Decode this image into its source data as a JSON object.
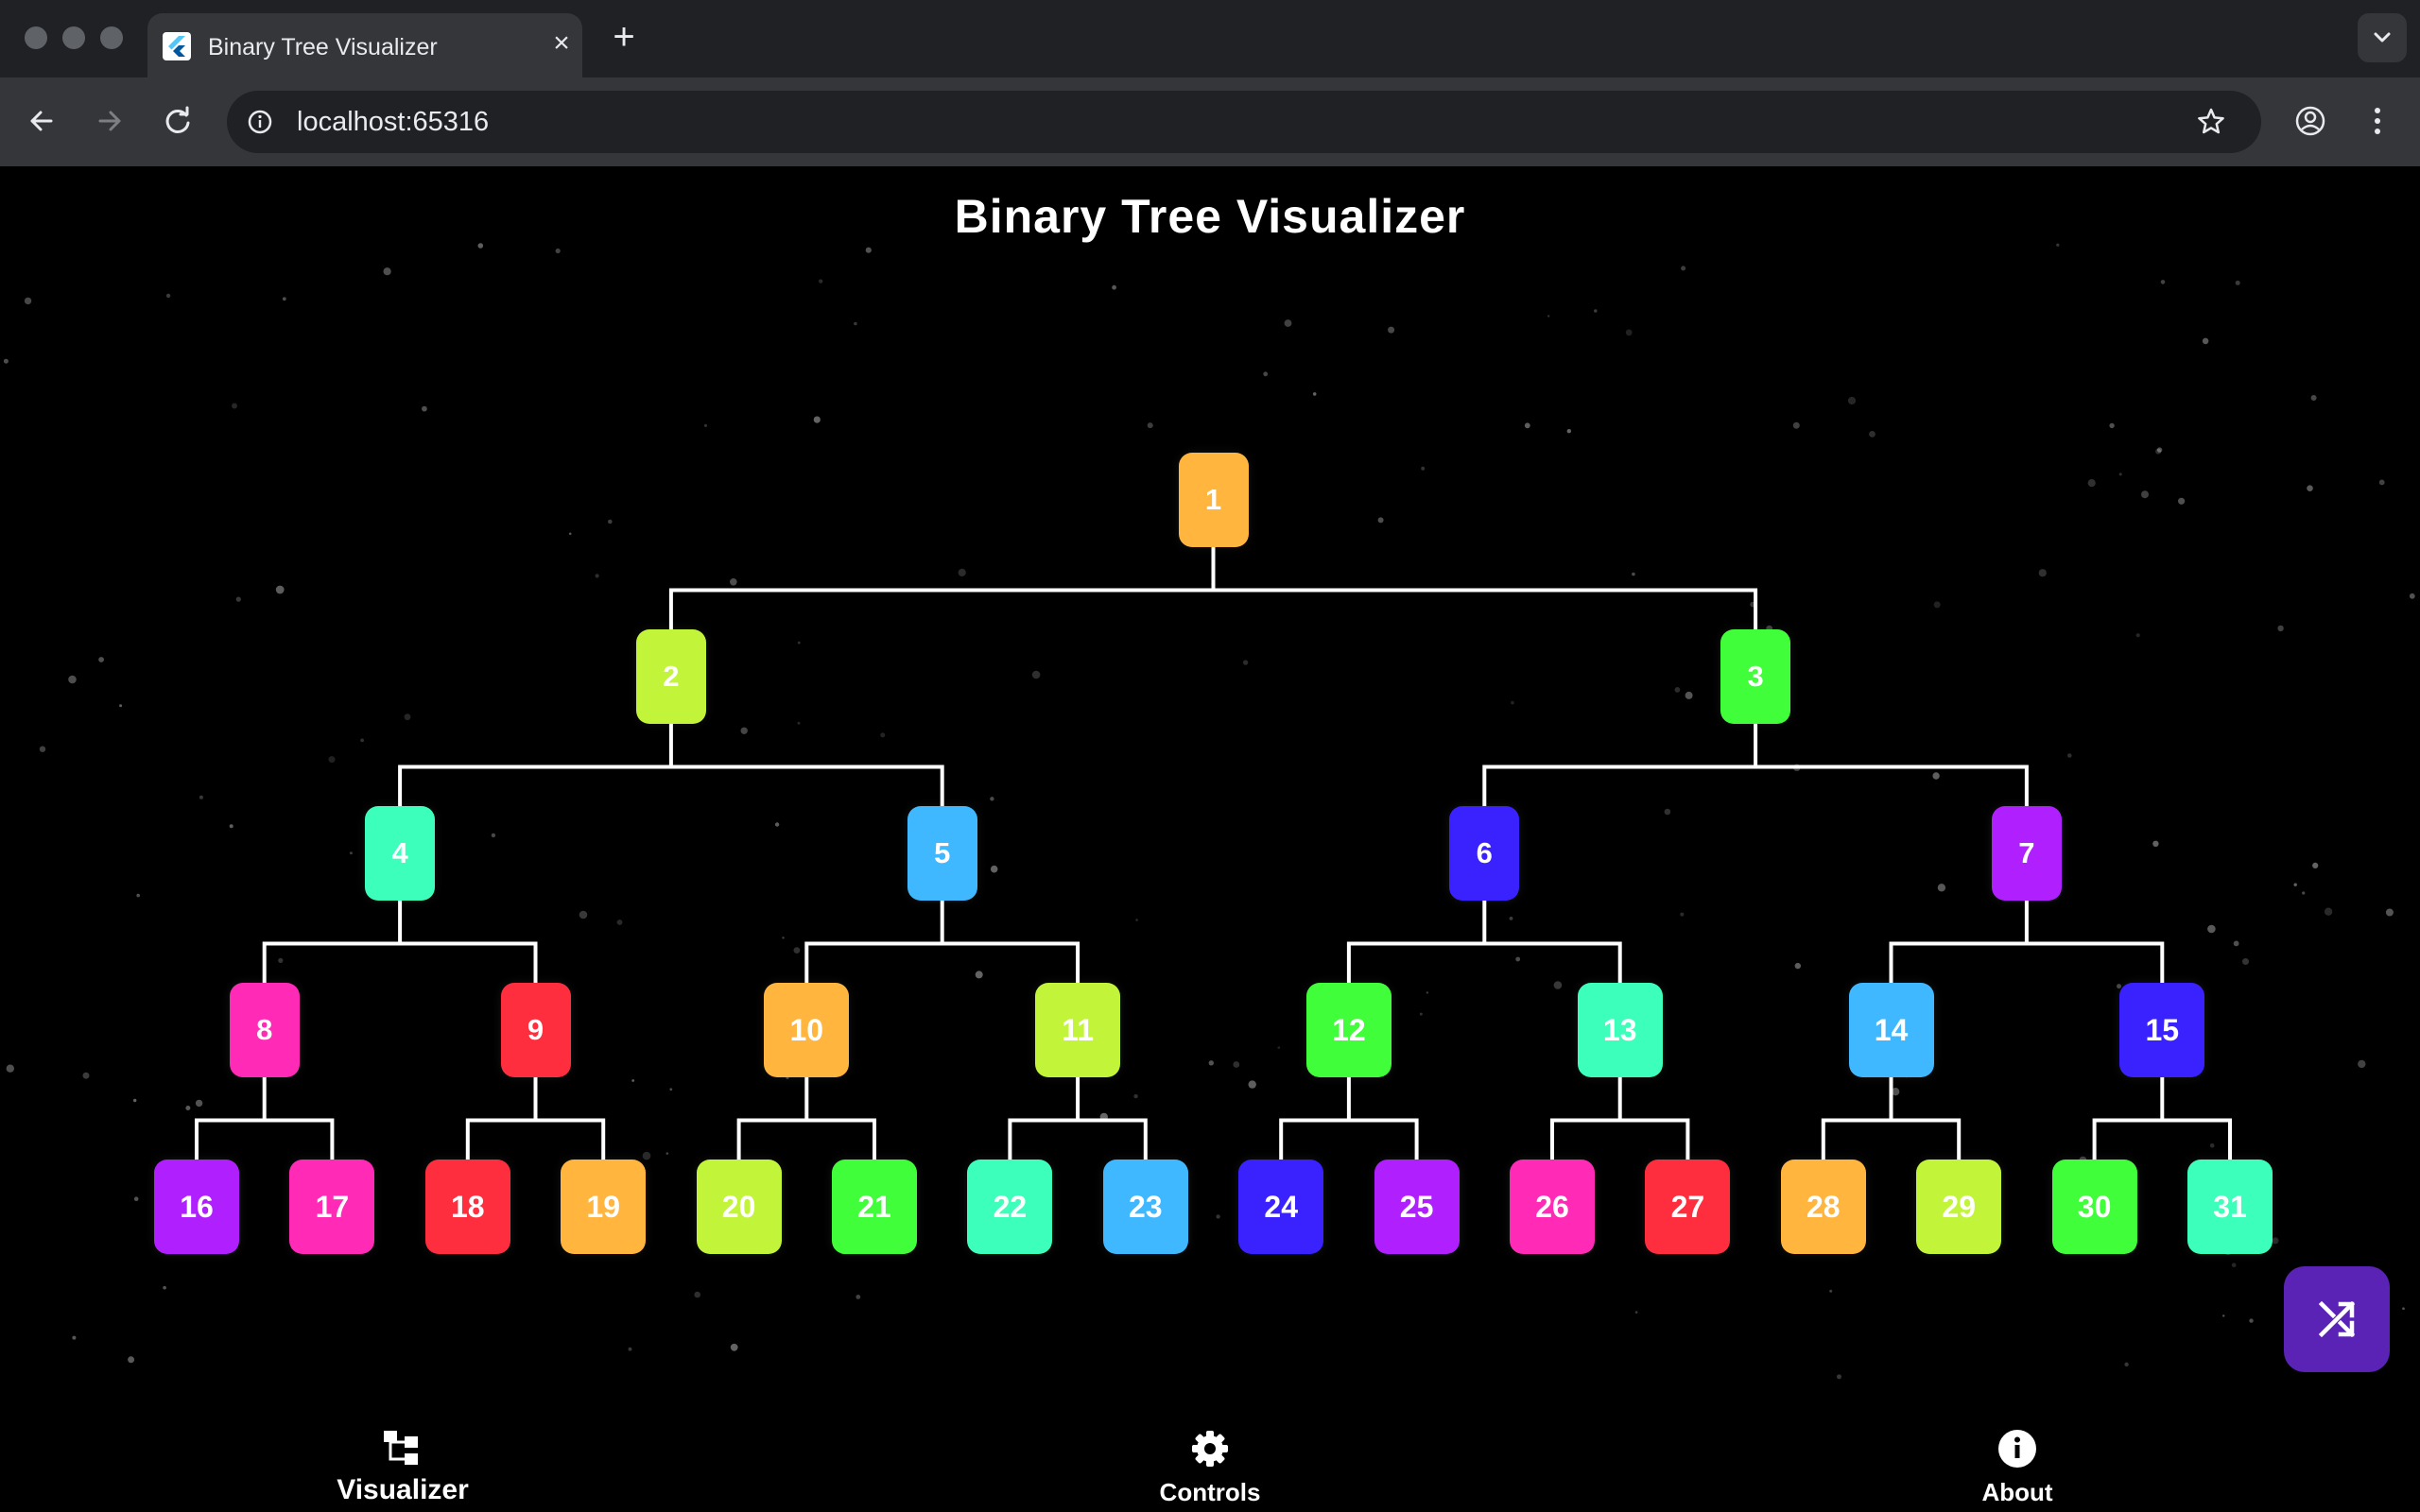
{
  "browser": {
    "tab_title": "Binary Tree Visualizer",
    "url": "localhost:65316"
  },
  "app": {
    "title": "Binary Tree Visualizer",
    "nodes": [
      {
        "value": "1",
        "color": "#FFB53E"
      },
      {
        "value": "2",
        "color": "#C2F53A"
      },
      {
        "value": "3",
        "color": "#40FF3A"
      },
      {
        "value": "4",
        "color": "#3CFFBB"
      },
      {
        "value": "5",
        "color": "#3FB8FF"
      },
      {
        "value": "6",
        "color": "#3A22FF"
      },
      {
        "value": "7",
        "color": "#B020FF"
      },
      {
        "value": "8",
        "color": "#FF2AB6"
      },
      {
        "value": "9",
        "color": "#FF2E3E"
      },
      {
        "value": "10",
        "color": "#FFB53E"
      },
      {
        "value": "11",
        "color": "#C2F53A"
      },
      {
        "value": "12",
        "color": "#40FF3A"
      },
      {
        "value": "13",
        "color": "#3CFFBB"
      },
      {
        "value": "14",
        "color": "#3FB8FF"
      },
      {
        "value": "15",
        "color": "#3A22FF"
      },
      {
        "value": "16",
        "color": "#B020FF"
      },
      {
        "value": "17",
        "color": "#FF2AB6"
      },
      {
        "value": "18",
        "color": "#FF2E3E"
      },
      {
        "value": "19",
        "color": "#FFB53E"
      },
      {
        "value": "20",
        "color": "#C2F53A"
      },
      {
        "value": "21",
        "color": "#40FF3A"
      },
      {
        "value": "22",
        "color": "#3CFFBB"
      },
      {
        "value": "23",
        "color": "#3FB8FF"
      },
      {
        "value": "24",
        "color": "#3A22FF"
      },
      {
        "value": "25",
        "color": "#B020FF"
      },
      {
        "value": "26",
        "color": "#FF2AB6"
      },
      {
        "value": "27",
        "color": "#FF2E3E"
      },
      {
        "value": "28",
        "color": "#FFB53E"
      },
      {
        "value": "29",
        "color": "#C2F53A"
      },
      {
        "value": "30",
        "color": "#40FF3A"
      },
      {
        "value": "31",
        "color": "#3CFFBB"
      }
    ],
    "fab_icon": "shuffle-icon",
    "fab_color": "#5B23B5"
  },
  "bottom_nav": [
    {
      "label": "Visualizer",
      "icon": "tree-icon",
      "active": true
    },
    {
      "label": "Controls",
      "icon": "gear-icon",
      "active": false
    },
    {
      "label": "About",
      "icon": "info-icon",
      "active": false
    }
  ]
}
